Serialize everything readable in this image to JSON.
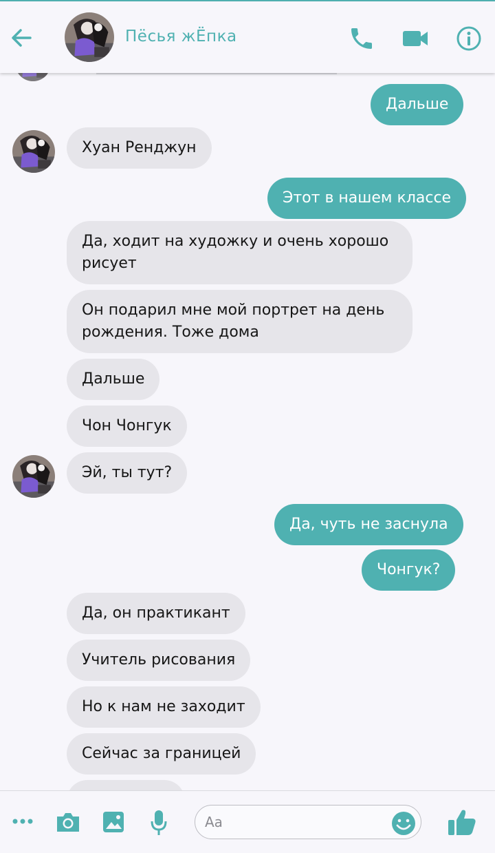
{
  "header": {
    "title": "Пёсья жЁпка"
  },
  "composer": {
    "placeholder": "Aa"
  },
  "messages": [
    {
      "text": "Дальше"
    },
    {
      "text": "Хуан Ренджун"
    },
    {
      "text": "Этот в нашем классе"
    },
    {
      "text": "Да, ходит на художку и очень хорошо рисует"
    },
    {
      "text": "Он подарил мне мой портрет на день рождения. Тоже дома"
    },
    {
      "text": "Дальше"
    },
    {
      "text": "Чон Чонгук"
    },
    {
      "text": "Эй, ты тут?"
    },
    {
      "text": "Да, чуть не заснула"
    },
    {
      "text": "Чонгук?"
    },
    {
      "text": "Да, он практикант"
    },
    {
      "text": "Учитель рисования"
    },
    {
      "text": "Но к нам не заходит"
    },
    {
      "text": "Сейчас за границей"
    }
  ],
  "colors": {
    "accent": "#4fb1b1",
    "incoming_bubble": "#e6e5ea",
    "background": "#f7f6fb"
  },
  "icons": [
    "back-arrow-icon",
    "phone-icon",
    "video-camera-icon",
    "info-icon",
    "more-icon",
    "camera-icon",
    "image-icon",
    "microphone-icon",
    "emoji-icon",
    "thumbs-up-icon"
  ]
}
